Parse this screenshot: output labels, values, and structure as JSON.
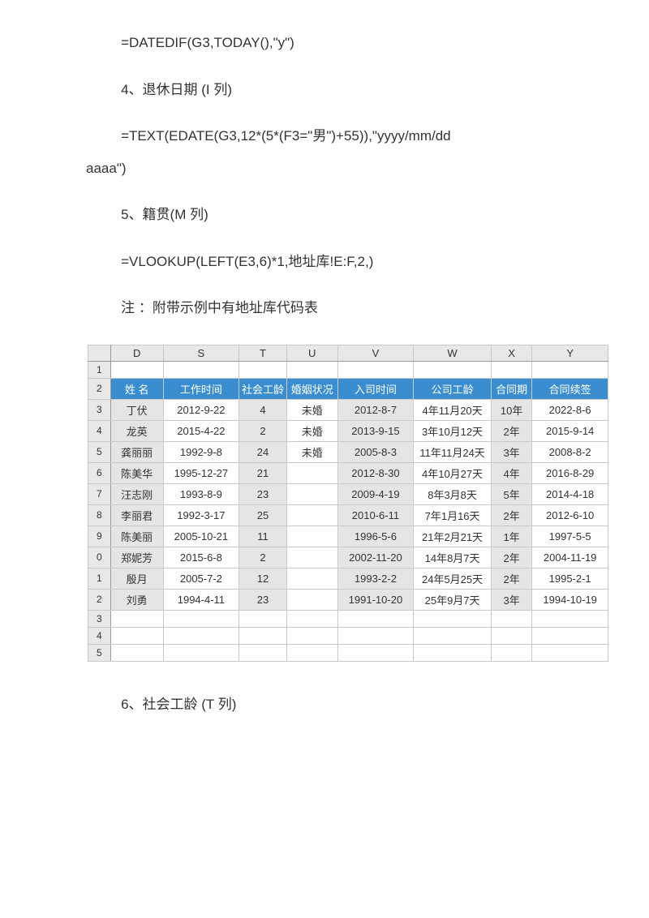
{
  "paragraphs": {
    "p1": "=DATEDIF(G3,TODAY(),\"y\")",
    "p2": "4、退休日期  (I 列)",
    "p3a": "=TEXT(EDATE(G3,12*(5*(F3=\"男\")+55)),\"yyyy/mm/dd",
    "p3b": "aaaa\")",
    "p4": "5、籍贯(M 列)",
    "p5": "=VLOOKUP(LEFT(E3,6)*1,地址库!E:F,2,)",
    "p6": "注 ：附带示例中有地址库代码表",
    "p7": "6、社会工龄 (T 列)"
  },
  "sheet": {
    "col_letters": [
      "D",
      "S",
      "T",
      "U",
      "V",
      "W",
      "X",
      "Y"
    ],
    "row_numbers_visible": [
      "1",
      "2",
      "3",
      "4",
      "5",
      "6",
      "7",
      "8",
      "9",
      "0",
      "1",
      "2",
      "3",
      "4",
      "5"
    ],
    "headers": [
      "姓 名",
      "工作时间",
      "社会工龄",
      "婚姻状况",
      "入司时间",
      "公司工龄",
      "合同期",
      "合同续签"
    ],
    "rows": [
      {
        "name": "丁伏",
        "work": "2012-9-22",
        "soc": "4",
        "mar": "未婚",
        "join": "2012-8-7",
        "comp": "4年11月20天",
        "term": "10年",
        "renew": "2022-8-6"
      },
      {
        "name": "龙英",
        "work": "2015-4-22",
        "soc": "2",
        "mar": "未婚",
        "join": "2013-9-15",
        "comp": "3年10月12天",
        "term": "2年",
        "renew": "2015-9-14"
      },
      {
        "name": "龚丽丽",
        "work": "1992-9-8",
        "soc": "24",
        "mar": "未婚",
        "join": "2005-8-3",
        "comp": "11年11月24天",
        "term": "3年",
        "renew": "2008-8-2"
      },
      {
        "name": "陈美华",
        "work": "1995-12-27",
        "soc": "21",
        "mar": "",
        "join": "2012-8-30",
        "comp": "4年10月27天",
        "term": "4年",
        "renew": "2016-8-29"
      },
      {
        "name": "汪志刚",
        "work": "1993-8-9",
        "soc": "23",
        "mar": "",
        "join": "2009-4-19",
        "comp": "8年3月8天",
        "term": "5年",
        "renew": "2014-4-18"
      },
      {
        "name": "李丽君",
        "work": "1992-3-17",
        "soc": "25",
        "mar": "",
        "join": "2010-6-11",
        "comp": "7年1月16天",
        "term": "2年",
        "renew": "2012-6-10"
      },
      {
        "name": "陈美丽",
        "work": "2005-10-21",
        "soc": "11",
        "mar": "",
        "join": "1996-5-6",
        "comp": "21年2月21天",
        "term": "1年",
        "renew": "1997-5-5"
      },
      {
        "name": "郑妮芳",
        "work": "2015-6-8",
        "soc": "2",
        "mar": "",
        "join": "2002-11-20",
        "comp": "14年8月7天",
        "term": "2年",
        "renew": "2004-11-19"
      },
      {
        "name": "殷月",
        "work": "2005-7-2",
        "soc": "12",
        "mar": "",
        "join": "1993-2-2",
        "comp": "24年5月25天",
        "term": "2年",
        "renew": "1995-2-1"
      },
      {
        "name": "刘勇",
        "work": "1994-4-11",
        "soc": "23",
        "mar": "",
        "join": "1991-10-20",
        "comp": "25年9月7天",
        "term": "3年",
        "renew": "1994-10-19"
      }
    ]
  }
}
